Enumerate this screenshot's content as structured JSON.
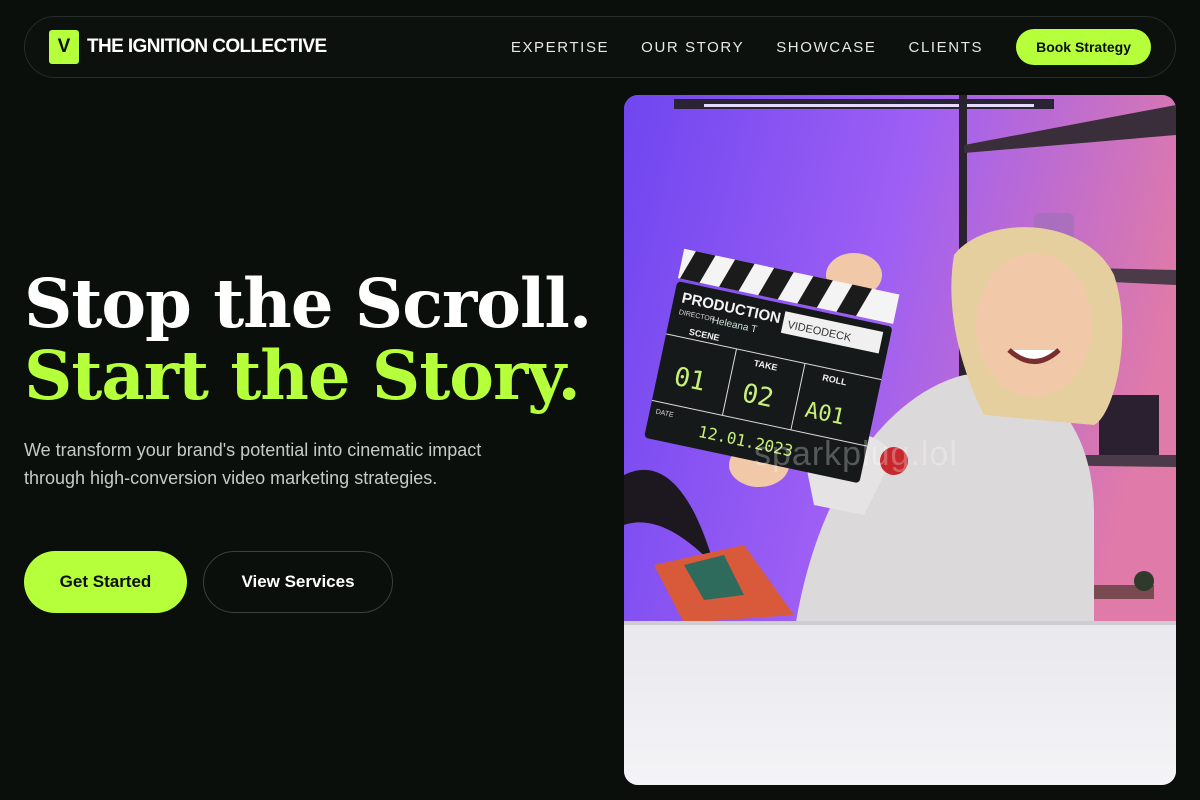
{
  "brand": {
    "logo_letter": "V",
    "name": "THE IGNITION COLLECTIVE"
  },
  "nav": {
    "links": [
      "EXPERTISE",
      "OUR STORY",
      "SHOWCASE",
      "CLIENTS"
    ],
    "cta_label": "Book Strategy"
  },
  "hero": {
    "title_line1": "Stop the Scroll.",
    "title_line2": "Start the Story.",
    "description": "We transform your brand's potential into cinematic impact through high-conversion video marketing strategies.",
    "primary_button": "Get Started",
    "secondary_button": "View Services"
  },
  "photo": {
    "clapper_production": "PRODUCTION",
    "clapper_director": "DIRECTOR",
    "clapper_director_name": "Heleana T",
    "clapper_company": "VIDEODECK",
    "clapper_scene": "SCENE",
    "clapper_take": "TAKE",
    "clapper_roll": "ROLL",
    "clapper_scene_value": "01",
    "clapper_take_value": "02",
    "clapper_roll_value": "A01",
    "clapper_date_label": "DATE",
    "clapper_date_value": "12.01.2023",
    "watermark": "sparkplug.lol"
  },
  "colors": {
    "accent": "#b6ff3b",
    "background": "#0a0f0b",
    "text": "#ffffff"
  }
}
